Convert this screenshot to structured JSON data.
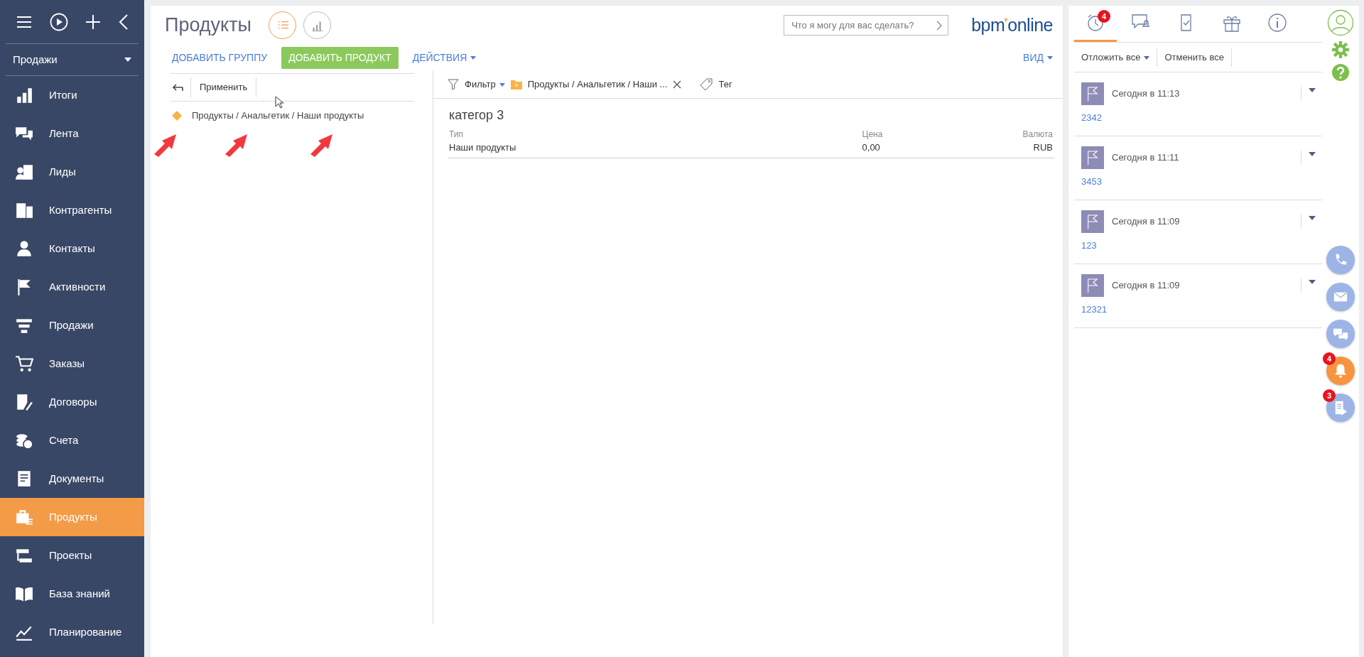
{
  "sidebar": {
    "workspace": "Продажи",
    "items": [
      {
        "label": "Итоги",
        "selected": false
      },
      {
        "label": "Лента",
        "selected": false
      },
      {
        "label": "Лиды",
        "selected": false
      },
      {
        "label": "Контрагенты",
        "selected": false
      },
      {
        "label": "Контакты",
        "selected": false
      },
      {
        "label": "Активности",
        "selected": false
      },
      {
        "label": "Продажи",
        "selected": false
      },
      {
        "label": "Заказы",
        "selected": false
      },
      {
        "label": "Договоры",
        "selected": false
      },
      {
        "label": "Счета",
        "selected": false
      },
      {
        "label": "Документы",
        "selected": false
      },
      {
        "label": "Продукты",
        "selected": true
      },
      {
        "label": "Проекты",
        "selected": false
      },
      {
        "label": "База знаний",
        "selected": false
      },
      {
        "label": "Планирование",
        "selected": false
      }
    ]
  },
  "header": {
    "title": "Продукты",
    "views": [
      {
        "selected": true
      },
      {
        "selected": false
      }
    ],
    "search": {
      "placeholder": "Что я могу для вас сделать?"
    },
    "logo": {
      "part_1": "bpm",
      "part_2": "online"
    }
  },
  "actions": [
    {
      "label": "ДОБАВИТЬ ГРУППУ",
      "kind": "link"
    },
    {
      "label": "ДОБАВИТЬ ПРОДУКТ",
      "kind": "primary"
    },
    {
      "label": "ДЕЙСТВИЯ",
      "kind": "dropdown"
    }
  ],
  "view_menu": "ВИД",
  "folder_panel": {
    "apply": "Применить",
    "folders": [
      {
        "label": "Продукты / Анальгетик / Наши продукты"
      }
    ]
  },
  "filter_bar": {
    "filter": "Фильтр",
    "folder_tag": "Продукты / Анальгетик / Наши ...",
    "tag": "Тег"
  },
  "grid": {
    "rows": [
      {
        "title": "категор 3",
        "fields": [
          {
            "label": "Тип",
            "value": "Наши продукты"
          },
          {
            "label": "Цена",
            "value": "0,00"
          },
          {
            "label": "Валюта",
            "value": "RUB"
          }
        ]
      }
    ]
  },
  "notifications": {
    "tabs": [
      {
        "selected": true,
        "badge": "4"
      },
      {
        "selected": false
      },
      {
        "selected": false
      },
      {
        "selected": false
      },
      {
        "selected": false
      }
    ],
    "postpone": "Отложить все",
    "cancel": "Отменить все",
    "items": [
      {
        "time": "Сегодня в 11:13",
        "subject": "2342"
      },
      {
        "time": "Сегодня в 11:11",
        "subject": "3453"
      },
      {
        "time": "Сегодня в 11:09",
        "subject": "123"
      },
      {
        "time": "Сегодня в 11:09",
        "subject": "12321"
      }
    ]
  },
  "side_buttons": [
    {
      "kind": "phone",
      "color": "#9cb4e6"
    },
    {
      "kind": "email",
      "color": "#9cb4e6"
    },
    {
      "kind": "chat",
      "color": "#9cb4e6"
    },
    {
      "kind": "bell",
      "color": "#f7953e",
      "badge": "4"
    },
    {
      "kind": "process",
      "color": "#9cb4e6",
      "badge": "3"
    }
  ]
}
